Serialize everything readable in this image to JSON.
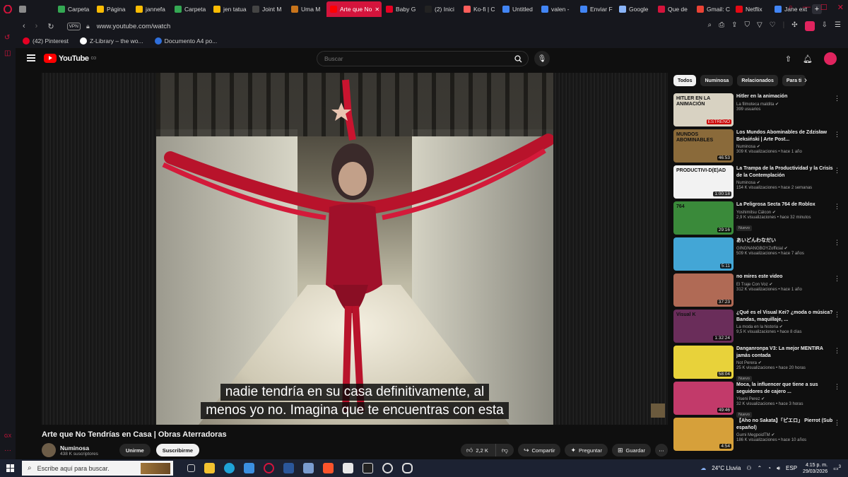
{
  "browser": {
    "tabs": [
      {
        "label": "",
        "fav": "#8a8a8a",
        "icon": "gamepad-icon"
      },
      {
        "label": "Carpeta",
        "fav": "#34a853"
      },
      {
        "label": "Página",
        "fav": "#fbbc04"
      },
      {
        "label": "jannefa",
        "fav": "#fbbc04"
      },
      {
        "label": "Carpeta",
        "fav": "#34a853"
      },
      {
        "label": "jen tatua",
        "fav": "#fbbc04"
      },
      {
        "label": "Joint M",
        "fav": "#444"
      },
      {
        "label": "Uma M",
        "fav": "#c8741b"
      },
      {
        "label": "Arte que No",
        "fav": "#ff0000",
        "active": true
      },
      {
        "label": "Baby G",
        "fav": "#e60023"
      },
      {
        "label": "(2) Inici",
        "fav": "#222"
      },
      {
        "label": "Ko-fi | C",
        "fav": "#ff5e5b"
      },
      {
        "label": "Untitled",
        "fav": "#4285f4"
      },
      {
        "label": "valen -",
        "fav": "#4285f4"
      },
      {
        "label": "Enviar F",
        "fav": "#4285f4"
      },
      {
        "label": "Google",
        "fav": "#8ab4f8"
      },
      {
        "label": "Que de",
        "fav": "#d4143c"
      },
      {
        "label": "Gmail: C",
        "fav": "#ea4335"
      },
      {
        "label": "Netflix",
        "fav": "#e50914"
      },
      {
        "label": "Jane ext",
        "fav": "#4285f4"
      }
    ],
    "url": "www.youtube.com/watch",
    "vpn_label": "VPN",
    "bookmarks": [
      {
        "label": "(42) Pinterest",
        "fav": "#e60023"
      },
      {
        "label": "Z-Library – the wo...",
        "fav": "#ffffff"
      },
      {
        "label": "Documento A4 po...",
        "fav": "#2f6fdc"
      }
    ]
  },
  "youtube": {
    "logo_text": "YouTube",
    "logo_sup": "CO",
    "search_placeholder": "Buscar",
    "video": {
      "title": "Arte que No Tendrías en Casa | Obras Aterradoras",
      "caption_line1": "nadie tendría en su casa definitivamente, al",
      "caption_line2": "menos yo no. Imagina que te encuentras con esta"
    },
    "channel": {
      "name": "Numinosa",
      "subscribers": "438 K suscriptores",
      "unjoin_label": "Unirme",
      "subscribe_label": "Suscribirme"
    },
    "actions": {
      "likes": "2,2 K",
      "share": "Compartir",
      "ask": "Preguntar",
      "save": "Guardar"
    },
    "chips": [
      "Todos",
      "Numinosa",
      "Relacionados",
      "Para ti"
    ],
    "recommendations": [
      {
        "title": "Hitler en la animación",
        "channel": "La filmoteca maldita",
        "meta": "399 usuarios",
        "duration": "ESTRENO",
        "thumb": "#d8d2c2",
        "thumb_text": "HITLER EN LA ANIMACIÓN"
      },
      {
        "title": "Los Mundos Abominables de Zdzisław Beksiński | Arte Post...",
        "channel": "Numinosa",
        "meta": "309 K visualizaciones • hace 1 año",
        "duration": "46:53",
        "thumb": "#8a6a3a",
        "thumb_text": "MUNDOS ABOMINABLES"
      },
      {
        "title": "La Trampa de la Productividad y la Crisis de la Contemplación",
        "channel": "Numinosa",
        "meta": "154 K visualizaciones • hace 2 semanas",
        "duration": "1:00:18",
        "thumb": "#f2f2f2",
        "thumb_text": "PRODUCTIVI-D(E)AD"
      },
      {
        "title": "La Peligrosa Secta 764 de Roblox",
        "channel": "Yoshimitsu Cálcon",
        "meta": "2,9 K visualizaciones • hace 32 minutos",
        "duration": "29:16",
        "thumb": "#3a8a3a",
        "badge": "Nuevo",
        "thumb_text": "764"
      },
      {
        "title": "あいどんわなだい",
        "channel": "GINGNANGBOYZofficial",
        "meta": "509 K visualizaciones • hace 7 años",
        "duration": "5:11",
        "thumb": "#43a6d6",
        "thumb_text": ""
      },
      {
        "title": "no mires este video",
        "channel": "El Traje Con Voz",
        "meta": "312 K visualizaciones • hace 1 año",
        "duration": "37:23",
        "thumb": "#b06a55",
        "thumb_text": ""
      },
      {
        "title": "¿Qué es el Visual Kei? ¿moda o música? Bandas, maquillaje, ...",
        "channel": "La moda en la historia",
        "meta": "9,5 K visualizaciones • hace 8 días",
        "duration": "1:32:24",
        "thumb": "#6a2d5a",
        "thumb_text": "Visual K"
      },
      {
        "title": "Danganronpa V3: La mejor MENTIRA jamás contada",
        "channel": "Not Perera",
        "meta": "25 K visualizaciones • hace 20 horas",
        "duration": "58:04",
        "thumb": "#e8d23a",
        "badge": "Nuevo",
        "thumb_text": ""
      },
      {
        "title": "Moca, la influencer que tiene a sus seguidores de cajero ...",
        "channel": "Yiseni Perez",
        "meta": "32 K visualizaciones • hace 3 horas",
        "duration": "49:46",
        "thumb": "#c23a6a",
        "badge": "Nuevo",
        "thumb_text": ""
      },
      {
        "title": "【Aho no Sakata】「ピエロ」 Pierrot (Sub español)",
        "channel": "Gumi MegpoidTM",
        "meta": "186 K visualizaciones • hace 10 años",
        "duration": "4:54",
        "thumb": "#d6a03a",
        "thumb_text": ""
      }
    ]
  },
  "taskbar": {
    "search_placeholder": "Escribe aquí para buscar.",
    "weather": "24°C  Lluvia",
    "lang": "ESP",
    "time": "4:15 p. m.",
    "date": "29/03/2026",
    "notif_count": "3"
  }
}
